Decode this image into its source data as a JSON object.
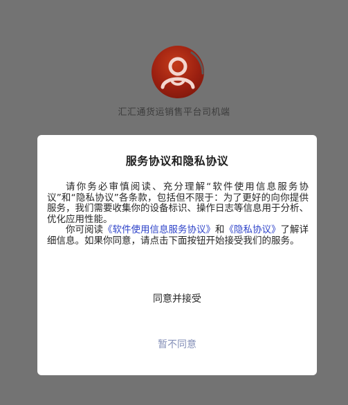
{
  "app": {
    "name": "汇汇通货运销售平台司机端",
    "logo_icon": "person-avatar-icon"
  },
  "dialog": {
    "title": "服务协议和隐私协议",
    "paragraph1": "请你务必审慎阅读、充分理解“软件使用信息服务协议”和“隐私协议”各条款，包括但不限于：为了更好的向你提供服务，我们需要收集你的设备标识、操作日志等信息用于分析、优化应用性能。",
    "paragraph2_prefix": "你可阅读",
    "link_service": "《软件使用信息服务协议》",
    "paragraph2_and": "和",
    "link_privacy": "《隐私协议》",
    "paragraph2_suffix": "了解详细信息。如果你同意，请点击下面按钮开始接受我们的服务。",
    "accept_label": "同意并接受",
    "reject_label": "暂不同意"
  },
  "colors": {
    "overlay_background": "#737373",
    "dialog_background": "#ffffff",
    "link": "#2f44c9",
    "reject_text": "#8590b8",
    "logo_red": "#9a1f10"
  }
}
